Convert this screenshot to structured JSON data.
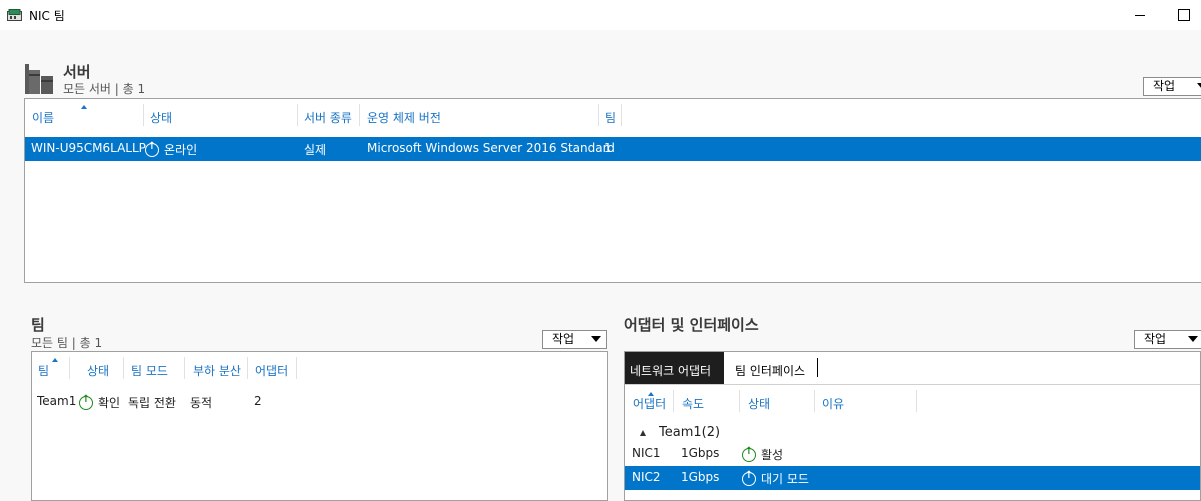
{
  "window": {
    "title": "NIC 팀",
    "app_icon": "nic-team-icon",
    "minimize_icon": "minimize-icon",
    "maximize_icon": "maximize-icon"
  },
  "servers": {
    "title": "서버",
    "subtitle": "모든 서버 | 총 1",
    "icon": "server-tile-icon",
    "task_label": "작업",
    "columns": [
      "이름",
      "상태",
      "서버 종류",
      "운영 체제 버전",
      "팀"
    ],
    "rows": [
      {
        "name": "WIN-U95CM6LALLP",
        "status": "온라인",
        "type": "실제",
        "os": "Microsoft Windows Server 2016 Standard",
        "teams": "1",
        "selected": true
      }
    ]
  },
  "teams": {
    "title": "팀",
    "subtitle": "모든 팀 | 총 1",
    "task_label": "작업",
    "columns": [
      "팀",
      "상태",
      "팀 모드",
      "부하 분산",
      "어댑터"
    ],
    "rows": [
      {
        "team": "Team1",
        "status": "확인",
        "mode": "독립 전환",
        "load": "동적",
        "adapters": "2"
      }
    ]
  },
  "adapters": {
    "title": "어댑터 및 인터페이스",
    "task_label": "작업",
    "tabs": [
      "네트워크 어댑터",
      "팀 인터페이스"
    ],
    "columns": [
      "어댑터",
      "속도",
      "상태",
      "이유"
    ],
    "group": "Team1(2)",
    "rows": [
      {
        "adapter": "NIC1",
        "speed": "1Gbps",
        "status": "활성",
        "reason": "",
        "selected": false
      },
      {
        "adapter": "NIC2",
        "speed": "1Gbps",
        "status": "대기 모드",
        "reason": "",
        "selected": true
      }
    ]
  },
  "colors": {
    "accent": "#0075c9",
    "header_text": "#1a73c5",
    "status_ok": "#1e8a1e"
  }
}
